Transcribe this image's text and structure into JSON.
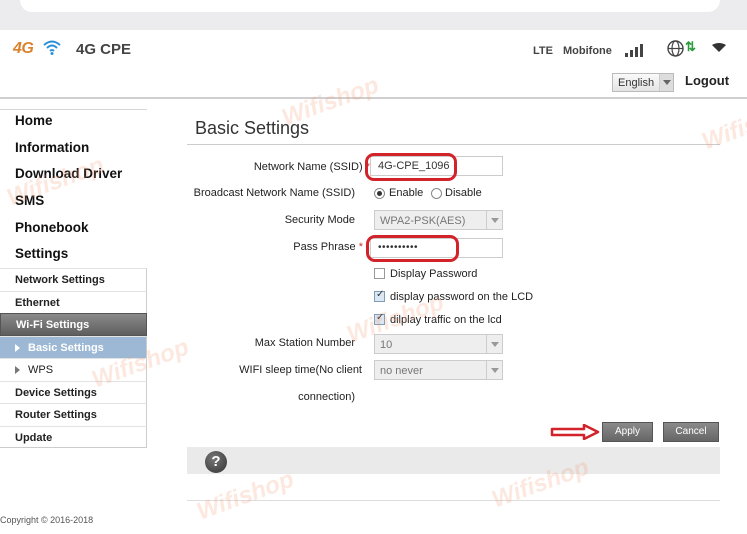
{
  "header": {
    "logo_4g": "4G",
    "product_name": "4G CPE",
    "network_type": "LTE",
    "carrier": "Mobifone",
    "language": "English",
    "logout_label": "Logout"
  },
  "sidebar": {
    "top_items": [
      {
        "label": "Home"
      },
      {
        "label": "Information"
      },
      {
        "label": "Download Driver"
      },
      {
        "label": "SMS"
      },
      {
        "label": "Phonebook"
      },
      {
        "label": "Settings"
      }
    ],
    "sub_items": [
      {
        "label": "Network Settings"
      },
      {
        "label": "Ethernet"
      },
      {
        "label": "Wi-Fi Settings"
      },
      {
        "label": "Basic Settings"
      },
      {
        "label": "WPS"
      },
      {
        "label": "Device Settings"
      },
      {
        "label": "Router Settings"
      },
      {
        "label": "Update"
      }
    ]
  },
  "main": {
    "title": "Basic Settings",
    "ssid": {
      "label": "Network Name (SSID)",
      "required": "*",
      "value": "4G-CPE_1096"
    },
    "broadcast": {
      "label": "Broadcast Network Name (SSID)",
      "enable": "Enable",
      "disable": "Disable",
      "selected": "Enable"
    },
    "security_mode": {
      "label": "Security Mode",
      "value": "WPA2-PSK(AES)"
    },
    "pass_phrase": {
      "label": "Pass Phrase",
      "required": "*",
      "value": "••••••••••"
    },
    "display_password": {
      "label": "Display Password",
      "checked": false
    },
    "display_lcd": {
      "label": "display password on the LCD",
      "checked": true
    },
    "display_traffic": {
      "label": "dilplay traffic on the lcd",
      "checked": true
    },
    "max_station": {
      "label": "Max Station Number",
      "value": "10"
    },
    "sleep_time": {
      "label_line1": "WIFI sleep time(No client",
      "label_line2": "connection)",
      "value": "no never"
    },
    "apply_label": "Apply",
    "cancel_label": "Cancel",
    "help_symbol": "?"
  },
  "footer": {
    "copyright": "Copyright © 2016-2018"
  },
  "watermark": "Wifishop",
  "colors": {
    "highlight_red": "#d3232a",
    "selected_blue": "#9cb8d4",
    "brand_orange": "#d9822b"
  }
}
